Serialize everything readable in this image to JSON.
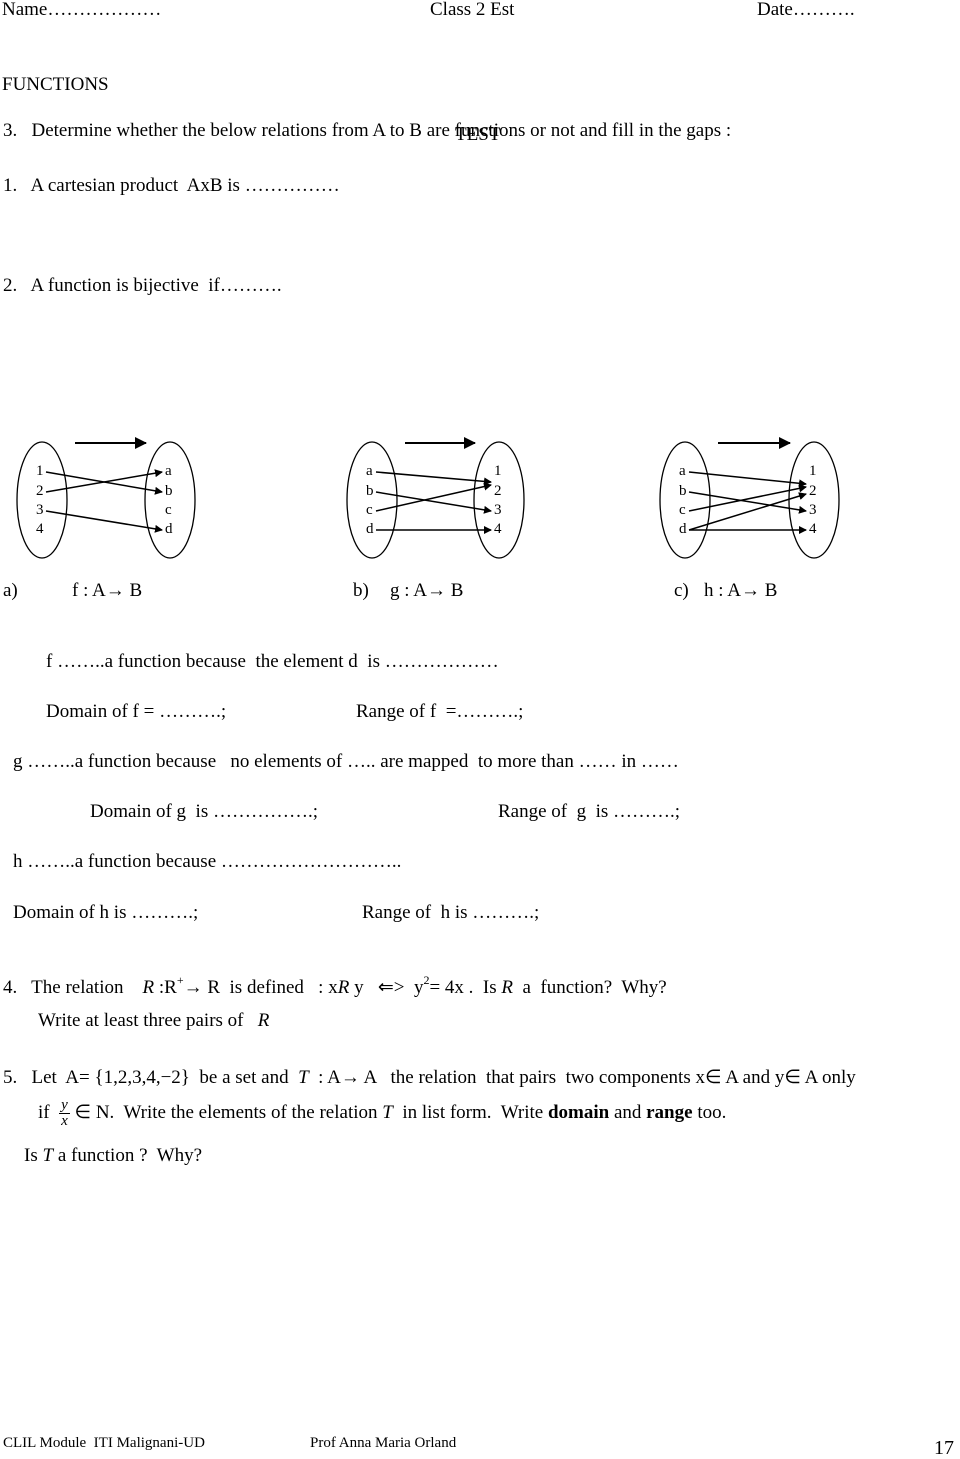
{
  "header": {
    "name": "Name………………",
    "class": "Class 2 Est",
    "date": "Date………."
  },
  "title": "FUNCTIONS",
  "subtitle": "TEST",
  "questions": {
    "q1": "1.   A cartesian product  AxB is ……………",
    "q2": "2.   A function is bijective  if……….",
    "q3": "3.   Determine whether the below relations from A to B are functions or not and fill in the gaps :",
    "q4": {
      "num": "4.",
      "text1": "The relation",
      "R": "R",
      "rel_def": ":R",
      "sup_plus": "+",
      "arrow_R": "→ R  is defined   : x",
      "y_part": " y   ⇐>  y",
      "sup2": "2",
      "eq": "= 4x .  Is ",
      "tail": "  a  function?  Why?",
      "line2": "Write at least three pairs of"
    },
    "q5": {
      "line1_a": "5.   Let  A= {1,2,3,4,−2}  be a set and  ",
      "T": "T",
      "line1_b": "  : A→ A   the relation  that pairs  two components x∈ A and y∈ A only",
      "if": "if",
      "frac_num": "y",
      "frac_den": "x",
      "line2_a": "∈ N.  Write the elements of the relation ",
      "line2_b": "  in list form.  Write ",
      "domain": "domain",
      "and": " and ",
      "range": "range",
      "too": " too.",
      "line3_a": "Is ",
      "line3_b": " a function ?  Why?"
    }
  },
  "diagrams": [
    {
      "left": [
        "1",
        "2",
        "3",
        "4"
      ],
      "right": [
        "a",
        "b",
        "c",
        "d"
      ],
      "caption_letter": "a)",
      "caption": "f : A→ B"
    },
    {
      "left": [
        "a",
        "b",
        "c",
        "d"
      ],
      "right": [
        "1",
        "2",
        "3",
        "4"
      ],
      "caption_letter": "b)",
      "caption": "g : A→ B"
    },
    {
      "left": [
        "a",
        "b",
        "c",
        "d"
      ],
      "right": [
        "1",
        "2",
        "3",
        "4"
      ],
      "caption_letter": "c)",
      "caption": "h : A→ B"
    }
  ],
  "gaps": {
    "f_line": "f ……..a function because  the element d  is ………………",
    "f_domain": "Domain of f = ……….;",
    "f_range": "Range of f  =……….;",
    "g_line": "g ……..a function because   no elements of ….. are mapped  to more than …… in ……",
    "g_domain": "Domain of g  is …………….;",
    "g_range": "Range of  g  is ……….;",
    "h_line": "h ……..a function because ………………………..",
    "h_domain": "Domain of h is ……….;",
    "h_range": "Range of  h is ……….;"
  },
  "footer": {
    "left": "CLIL Module  ITI Malignani-UD",
    "author": "Prof Anna Maria Orland",
    "page": "17"
  }
}
